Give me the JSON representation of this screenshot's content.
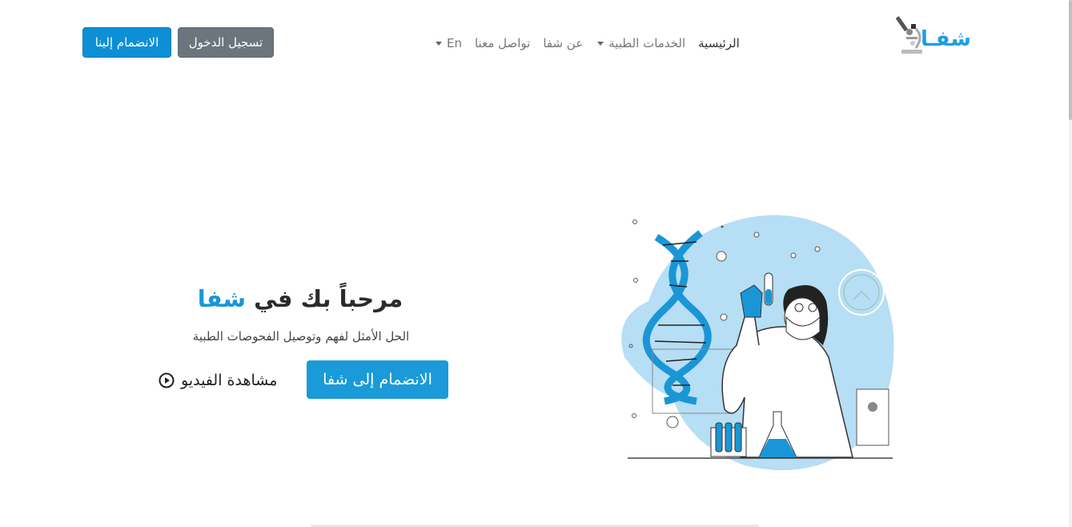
{
  "nav": {
    "join_button": "الانضمام إلينا",
    "login_button": "تسجيل الدخول",
    "links": [
      {
        "label": "الرئيسية",
        "active": true
      },
      {
        "label": "الخدمات الطبية",
        "dropdown": true
      },
      {
        "label": "عن شفا"
      },
      {
        "label": "تواصل معنا"
      },
      {
        "label": "En",
        "dropdown": true
      }
    ],
    "logo_text": "شفـا"
  },
  "hero": {
    "title_prefix": "مرحباً بك في ",
    "title_brand": "شفا",
    "subtitle": "الحل الأمثل لفهم وتوصيل الفحوصات الطبية",
    "cta_button": "الانضمام إلى شفا",
    "watch_video": "مشاهدة الفيديو"
  },
  "colors": {
    "primary": "#1a9ad8",
    "secondary": "#6c757d",
    "text": "#212529"
  },
  "icons": {
    "logo": "microscope-icon",
    "watch": "play-circle-icon",
    "illustration": "scientist-dna-illustration"
  }
}
